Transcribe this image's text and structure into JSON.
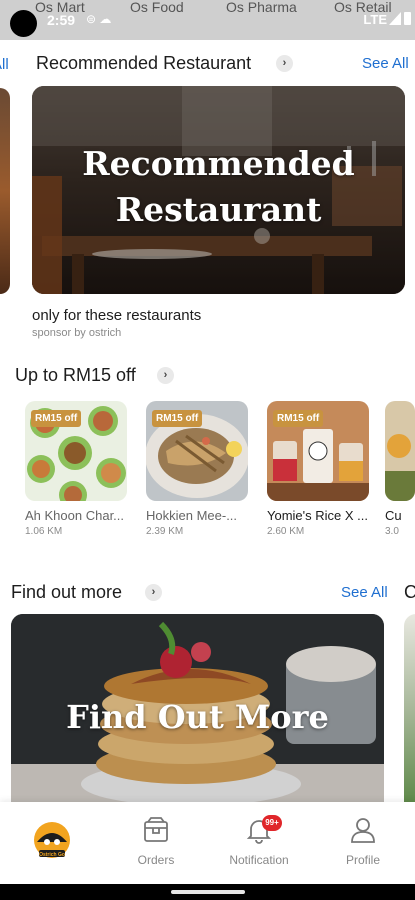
{
  "status_bar": {
    "tabs": [
      "Os Mart",
      "Os Food",
      "Os Pharma",
      "Os Retail"
    ],
    "time": "2:59",
    "network": "LTE"
  },
  "recommended": {
    "title": "Recommended Restaurant",
    "see_all": "See All",
    "banner_text_line1": "Recommended",
    "banner_text_line2": "Restaurant",
    "subtitle": "only for these restaurants",
    "sponsor": "sponsor by ostrich"
  },
  "deals": {
    "title": "Up to RM15 off",
    "items": [
      {
        "badge": "RM15 off",
        "name": "Ah Khoon Char...",
        "distance": "1.06 KM"
      },
      {
        "badge": "RM15 off",
        "name": "Hokkien Mee-...",
        "distance": "2.39 KM"
      },
      {
        "badge": "RM15 off",
        "name": "Yomie's Rice X ...",
        "distance": "2.60 KM"
      },
      {
        "badge": "",
        "name": "Cu",
        "distance": "3.0"
      }
    ]
  },
  "find_out_more": {
    "title": "Find out more",
    "see_all": "See All",
    "banner_text": "Find Out More",
    "peek_letter": "C"
  },
  "peek_left_text": "All",
  "nav": {
    "home_label": "Ostrich Go",
    "orders": "Orders",
    "notification": "Notification",
    "notif_count": "99+",
    "profile": "Profile"
  },
  "icons": {
    "orders": "box-icon",
    "notification": "bell-icon",
    "profile": "person-icon",
    "home": "ostrich-logo-icon"
  },
  "colors": {
    "accent_blue": "#1f6fd0",
    "badge_gold": "#c8933f",
    "notif_red": "#e0262a",
    "logo_orange": "#f2a41f"
  }
}
